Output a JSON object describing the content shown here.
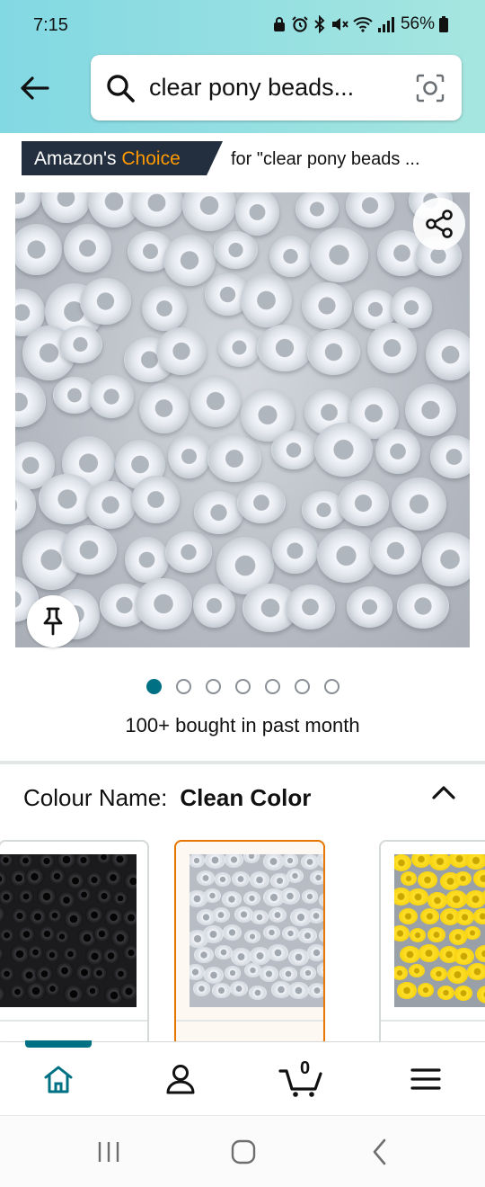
{
  "status_bar": {
    "time": "7:15",
    "battery": "56%"
  },
  "search": {
    "query": "clear pony beads..."
  },
  "badge": {
    "label_prefix": "Amazon's ",
    "label_accent": "Choice",
    "for_text": "for \"clear pony beads ...",
    "accent_color": "#ff9900"
  },
  "gallery": {
    "image_count": 7,
    "active_index": 0
  },
  "social_proof": {
    "bought_text": "100+ bought in past month"
  },
  "variation": {
    "label": "Colour Name:",
    "selected": "Clean Color",
    "swatches": [
      {
        "color_name": "black"
      },
      {
        "color_name": "clear",
        "selected": true
      },
      {
        "color_name": "yellow"
      }
    ]
  },
  "bottom_nav": {
    "items": [
      "home",
      "account",
      "cart",
      "menu"
    ],
    "active": "home",
    "cart_count": "0",
    "accent_color": "#007185"
  },
  "android_nav": {
    "items": [
      "recent-apps",
      "home",
      "back"
    ]
  }
}
